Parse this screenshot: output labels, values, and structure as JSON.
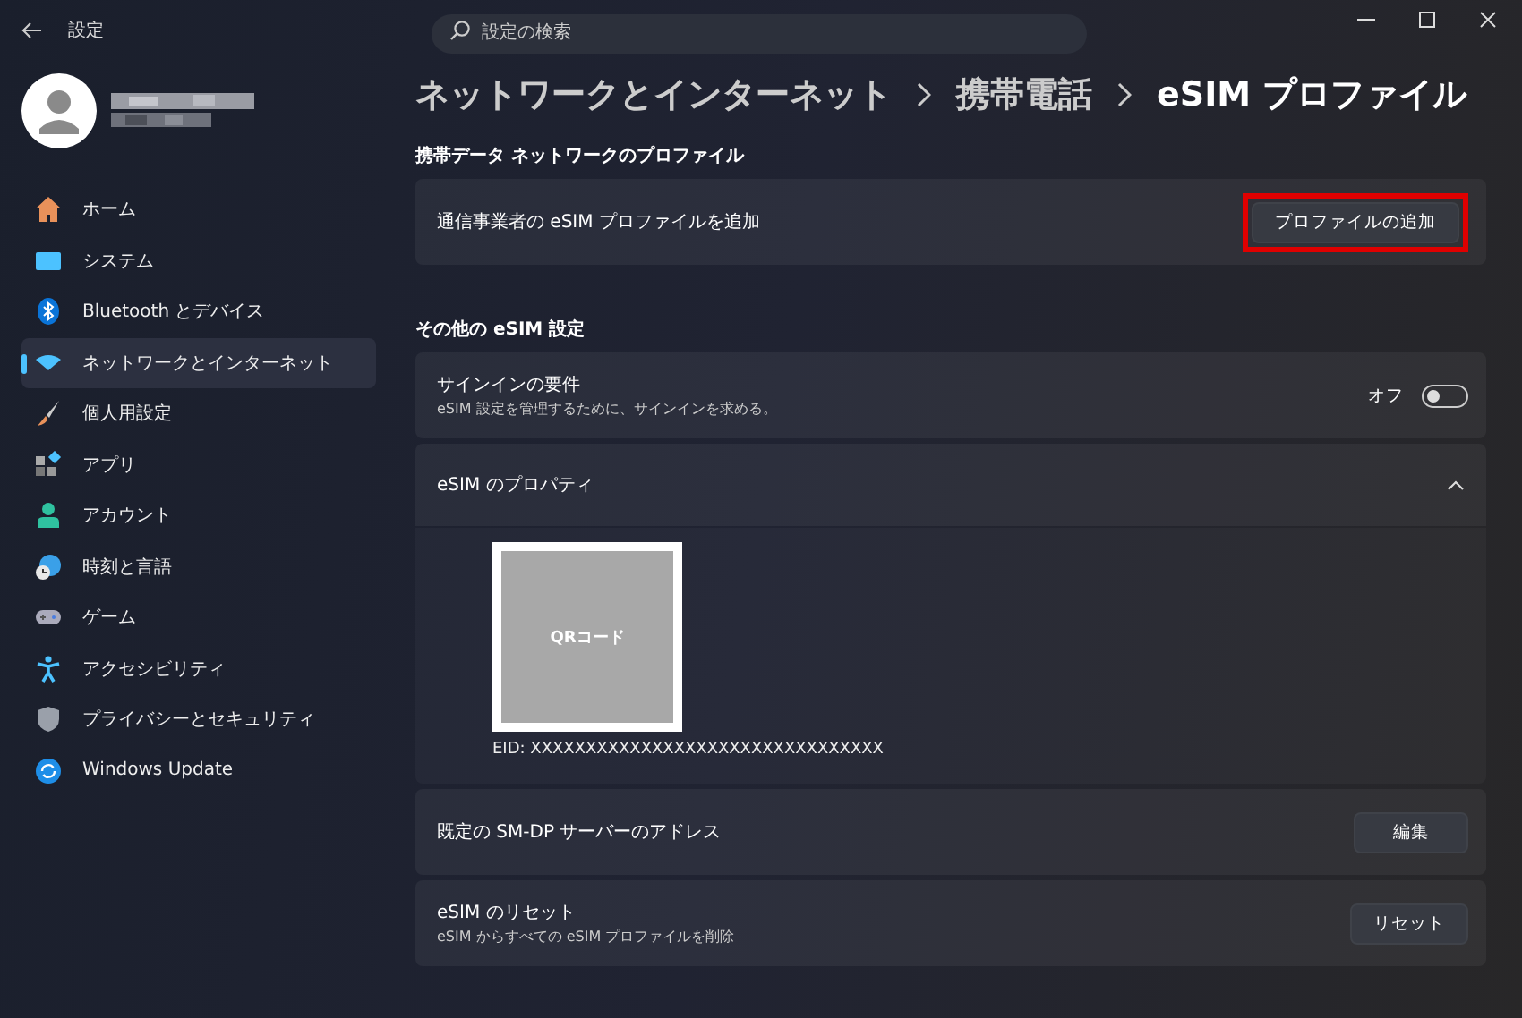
{
  "window": {
    "title": "設定"
  },
  "search": {
    "placeholder": "設定の検索"
  },
  "sidebar": {
    "items": [
      {
        "label": "ホーム",
        "kind": "home",
        "selected": false
      },
      {
        "label": "システム",
        "kind": "system",
        "selected": false
      },
      {
        "label": "Bluetooth とデバイス",
        "kind": "bluetooth",
        "selected": false
      },
      {
        "label": "ネットワークとインターネット",
        "kind": "network",
        "selected": true
      },
      {
        "label": "個人用設定",
        "kind": "brush",
        "selected": false
      },
      {
        "label": "アプリ",
        "kind": "apps",
        "selected": false
      },
      {
        "label": "アカウント",
        "kind": "account",
        "selected": false
      },
      {
        "label": "時刻と言語",
        "kind": "time",
        "selected": false
      },
      {
        "label": "ゲーム",
        "kind": "game",
        "selected": false
      },
      {
        "label": "アクセシビリティ",
        "kind": "access",
        "selected": false
      },
      {
        "label": "プライバシーとセキュリティ",
        "kind": "shield",
        "selected": false
      },
      {
        "label": "Windows Update",
        "kind": "update",
        "selected": false
      }
    ]
  },
  "breadcrumb": [
    "ネットワークとインターネット",
    "携帯電話",
    "eSIM プロファイル"
  ],
  "sections": [
    {
      "heading": "携帯データ ネットワークのプロファイル",
      "cards": [
        {
          "kind": "button",
          "title": "通信事業者の eSIM プロファイルを追加",
          "button": "プロファイルの追加",
          "highlighted": true
        }
      ]
    },
    {
      "heading": "その他の eSIM 設定",
      "cards": [
        {
          "kind": "toggle",
          "title": "サインインの要件",
          "subtitle": "eSIM 設定を管理するために、サインインを求める。",
          "state_label": "オフ",
          "on": false
        },
        {
          "kind": "expander",
          "title": "eSIM のプロパティ",
          "expanded": true,
          "qr_label": "QRコード",
          "eid": "EID: XXXXXXXXXXXXXXXXXXXXXXXXXXXXXXXX"
        },
        {
          "kind": "button",
          "title": "既定の SM-DP サーバーのアドレス",
          "button": "編集",
          "highlighted": false
        },
        {
          "kind": "button",
          "title": "eSIM のリセット",
          "subtitle": "eSIM からすべての eSIM プロファイルを削除",
          "button": "リセット",
          "highlighted": false
        }
      ]
    }
  ]
}
